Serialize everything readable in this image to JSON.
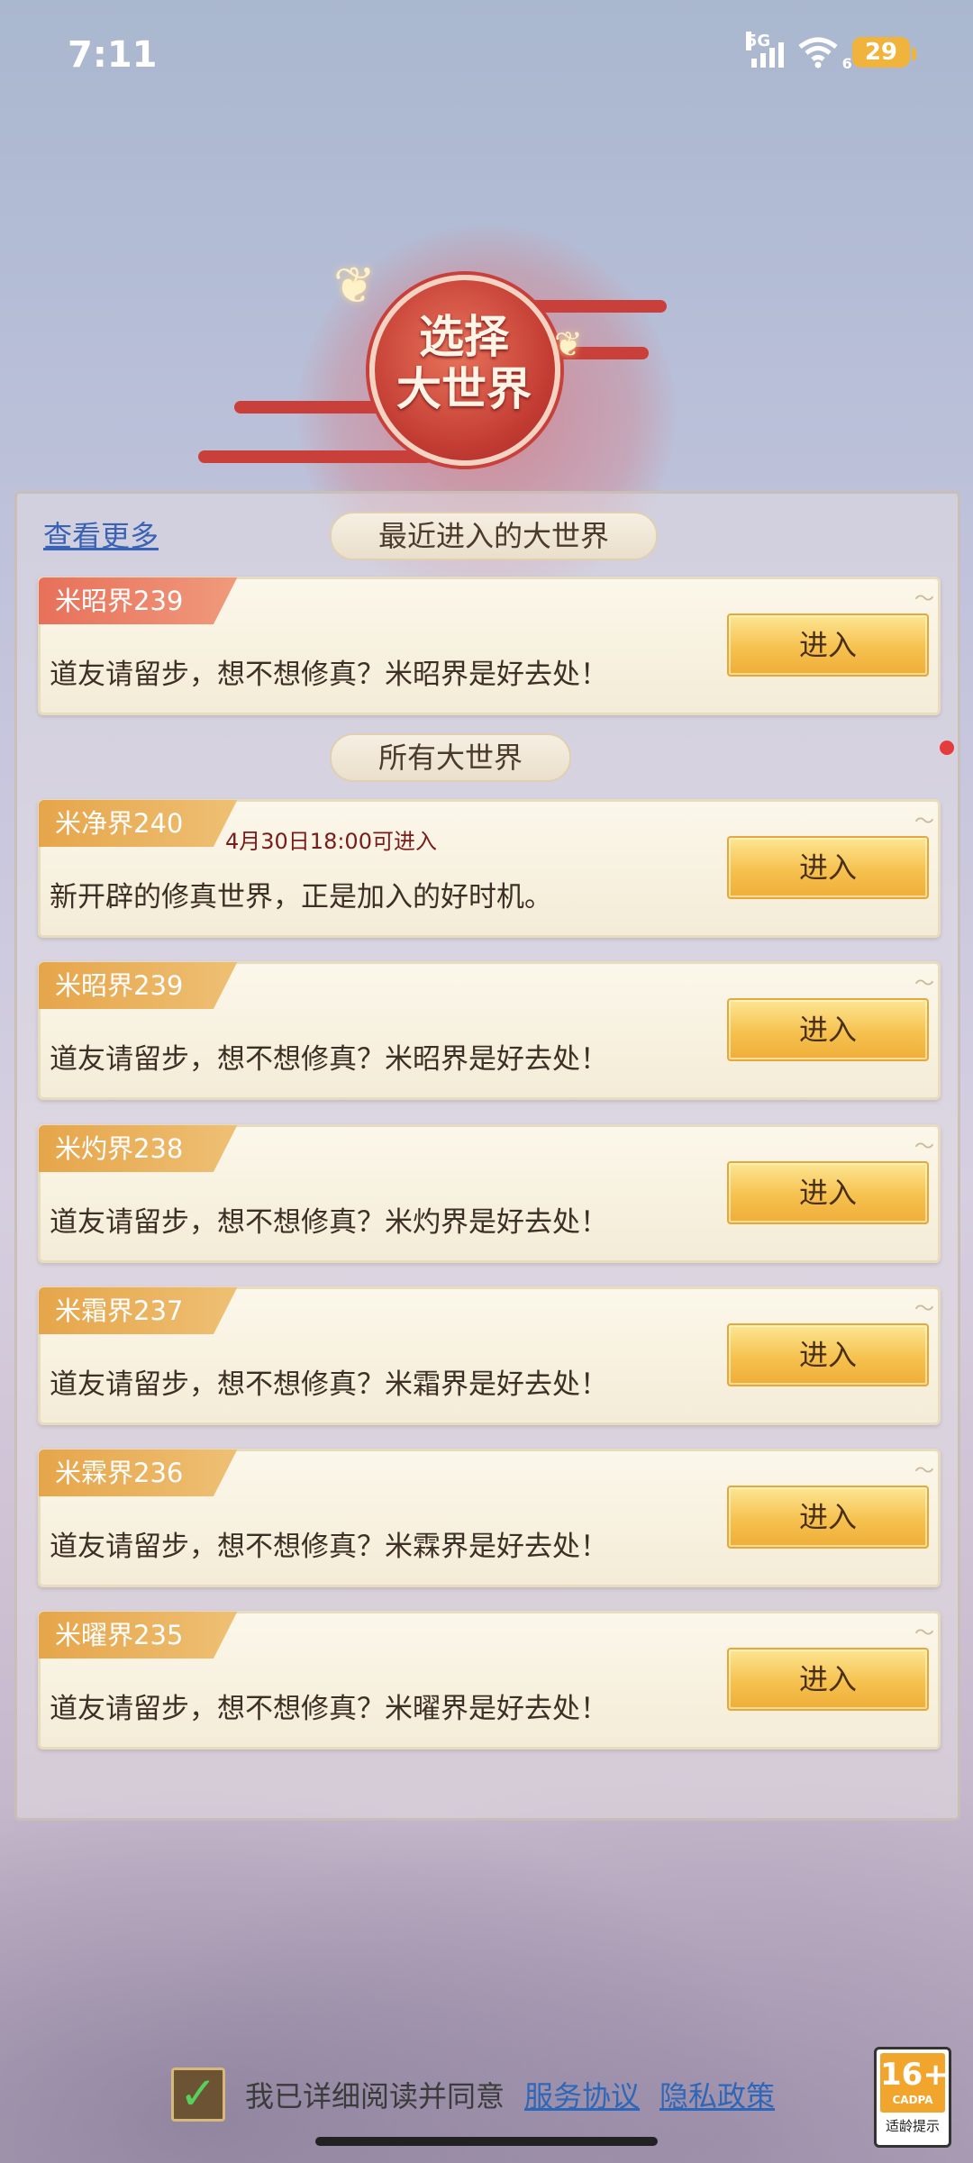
{
  "status_bar": {
    "time": "7:11",
    "network": "5G",
    "wifi_sub": "6",
    "battery": "29"
  },
  "header": {
    "emblem_title_line1": "选择",
    "emblem_title_line2": "大世界"
  },
  "recent": {
    "view_more_label": "查看更多",
    "section_title": "最近进入的大世界",
    "card": {
      "tag": "米昭界239",
      "desc": "道友请留步，想不想修真？米昭界是好去处！",
      "enter_label": "进入"
    }
  },
  "all": {
    "section_title": "所有大世界",
    "cards": [
      {
        "tag": "米净界240",
        "note": "4月30日18:00可进入",
        "desc": "新开辟的修真世界，正是加入的好时机。",
        "enter_label": "进入"
      },
      {
        "tag": "米昭界239",
        "note": "",
        "desc": "道友请留步，想不想修真？米昭界是好去处！",
        "enter_label": "进入"
      },
      {
        "tag": "米灼界238",
        "note": "",
        "desc": "道友请留步，想不想修真？米灼界是好去处！",
        "enter_label": "进入"
      },
      {
        "tag": "米霜界237",
        "note": "",
        "desc": "道友请留步，想不想修真？米霜界是好去处！",
        "enter_label": "进入"
      },
      {
        "tag": "米霖界236",
        "note": "",
        "desc": "道友请留步，想不想修真？米霖界是好去处！",
        "enter_label": "进入"
      },
      {
        "tag": "米曜界235",
        "note": "",
        "desc": "道友请留步，想不想修真？米曜界是好去处！",
        "enter_label": "进入"
      }
    ]
  },
  "footer": {
    "agree_text": "我已详细阅读并同意",
    "service_link": "服务协议",
    "privacy_link": "隐私政策",
    "checkbox_mark": "✓",
    "age_rating": "16+",
    "age_org": "CADPA",
    "age_note": "适龄提示"
  },
  "colors": {
    "accent_gold": "#f6c14f",
    "tag_gold": "#e6a54a",
    "tag_red": "#e8705a",
    "link_blue": "#2e66b8"
  }
}
